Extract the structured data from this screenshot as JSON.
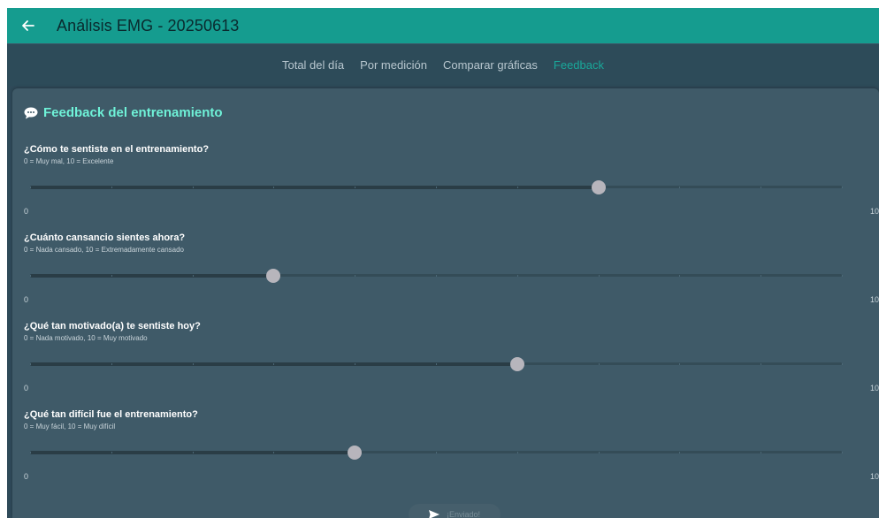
{
  "header": {
    "back_icon": "arrow-left-icon",
    "title": "Análisis EMG - 20250613"
  },
  "tabs": [
    {
      "label": "Total del día",
      "active": false
    },
    {
      "label": "Por medición",
      "active": false
    },
    {
      "label": "Comparar gráficas",
      "active": false
    },
    {
      "label": "Feedback",
      "active": true
    }
  ],
  "feedback": {
    "icon": "speech-bubble-icon",
    "title": "Feedback del entrenamiento",
    "questions": [
      {
        "label": "¿Cómo te sentiste en el entrenamiento?",
        "hint": "0 = Muy mal, 10 = Excelente",
        "value": 7,
        "min": "0",
        "max": "10"
      },
      {
        "label": "¿Cuánto cansancio sientes ahora?",
        "hint": "0 = Nada cansado, 10 = Extremadamente cansado",
        "value": 3,
        "min": "0",
        "max": "10"
      },
      {
        "label": "¿Qué tan motivado(a) te sentiste hoy?",
        "hint": "0 = Nada motivado, 10 = Muy motivado",
        "value": 6,
        "min": "0",
        "max": "10"
      },
      {
        "label": "¿Qué tan difícil fue el entrenamiento?",
        "hint": "0 = Muy fácil, 10 = Muy difícil",
        "value": 4,
        "min": "0",
        "max": "10"
      }
    ],
    "submit": {
      "icon": "send-icon",
      "label": "¡Enviado!"
    }
  },
  "colors": {
    "appbar": "#159c8f",
    "accent": "#6ff2d8",
    "active_tab": "#19a89a",
    "background": "#2f4a59",
    "card": "#3f5a68"
  }
}
